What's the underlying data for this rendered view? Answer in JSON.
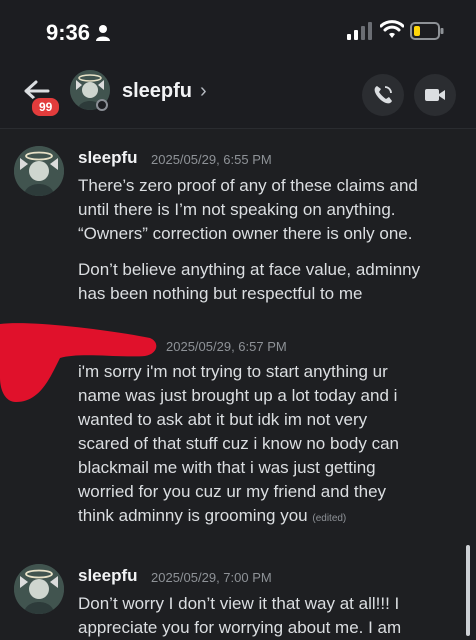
{
  "status_bar": {
    "time": "9:36"
  },
  "header": {
    "unread_count": "99",
    "name": "sleepfu",
    "chevron": "›"
  },
  "messages": [
    {
      "author": "sleepfu",
      "timestamp": "2025/05/29, 6:55 PM",
      "lines": [
        "There’s zero proof of any of these claims and",
        "until there is I’m not speaking on anything.",
        "“Owners” correction owner there is only one."
      ],
      "lines2": [
        "Don’t believe anything at face value, adminny",
        "has been nothing but respectful to me"
      ]
    },
    {
      "author": "",
      "timestamp": "2025/05/29, 6:57 PM",
      "lines": [
        "i'm sorry i'm not trying to start anything ur",
        "name was just brought up a lot today and i",
        "wanted to ask abt it but idk im not very",
        "scared of that stuff cuz i know no body can",
        "blackmail me with that i was just getting",
        "worried for you cuz ur my friend and they",
        "think adminny is grooming you"
      ],
      "edited_label": "(edited)"
    },
    {
      "author": "sleepfu",
      "timestamp": "2025/05/29, 7:00 PM",
      "lines": [
        "Don’t worry I don’t view it that way at all!!! I",
        "appreciate you for worrying about me. I am"
      ]
    }
  ],
  "colors": {
    "background": "#1e1f22",
    "badge": "#e23c3c",
    "redaction": "#e0112b"
  },
  "icons": [
    "person-icon",
    "signal-icon",
    "wifi-icon",
    "battery-icon",
    "back-arrow-icon",
    "phone-icon",
    "video-camera-icon"
  ]
}
